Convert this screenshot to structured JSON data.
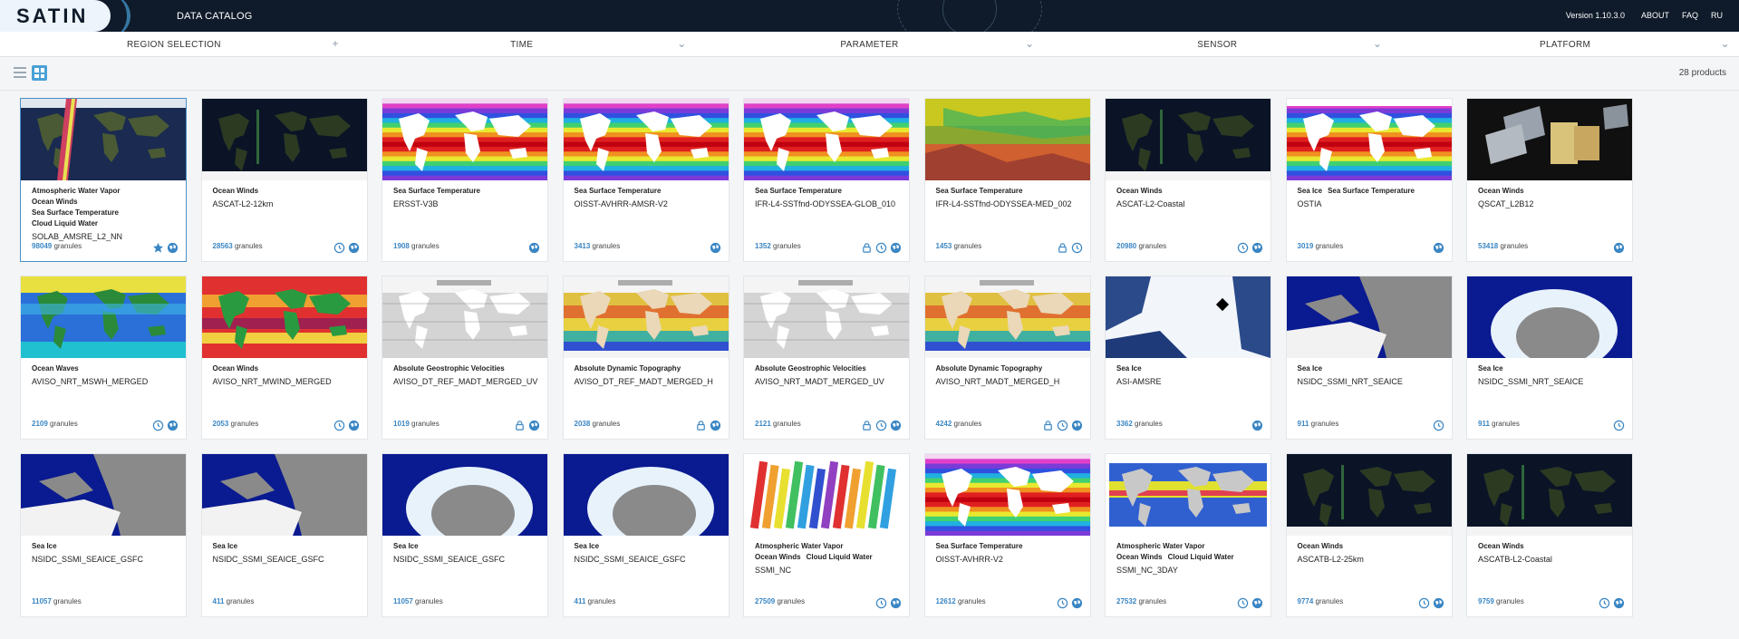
{
  "header": {
    "logo_text": "SATIN",
    "app_title": "DATA CATALOG",
    "version": "Version 1.10.3.0",
    "nav": [
      "ABOUT",
      "FAQ",
      "RU"
    ]
  },
  "filters": [
    {
      "label": "REGION SELECTION",
      "control": "+"
    },
    {
      "label": "TIME",
      "control": "⌄"
    },
    {
      "label": "PARAMETER",
      "control": "⌄"
    },
    {
      "label": "SENSOR",
      "control": "⌄"
    },
    {
      "label": "PLATFORM",
      "control": "⌄"
    }
  ],
  "toolbar": {
    "count_text": "28 products"
  },
  "colors": {
    "accent": "#3a86c4",
    "topbar": "#0f1b2a"
  },
  "granules_suffix": "granules",
  "products": [
    {
      "params": [
        "Atmospheric Water Vapor",
        "Ocean Winds",
        "Sea Surface Temperature",
        "Cloud Liquid Water"
      ],
      "name": "SOLAB_AMSRE_L2_NN",
      "count": "98049",
      "icons": [
        "star",
        "globe"
      ],
      "thumb": "swath",
      "selected": true
    },
    {
      "params": [
        "Ocean Winds"
      ],
      "name": "ASCAT-L2-12km",
      "count": "28563",
      "icons": [
        "clock",
        "globe"
      ],
      "thumb": "dark-earth"
    },
    {
      "params": [
        "Sea Surface Temperature"
      ],
      "name": "ERSST-V3B",
      "count": "1908",
      "icons": [
        "globe"
      ],
      "thumb": "sst"
    },
    {
      "params": [
        "Sea Surface Temperature"
      ],
      "name": "OISST-AVHRR-AMSR-V2",
      "count": "3413",
      "icons": [
        "globe"
      ],
      "thumb": "sst"
    },
    {
      "params": [
        "Sea Surface Temperature"
      ],
      "name": "IFR-L4-SSTfnd-ODYSSEA-GLOB_010",
      "count": "1352",
      "icons": [
        "lock",
        "clock",
        "globe"
      ],
      "thumb": "sst"
    },
    {
      "params": [
        "Sea Surface Temperature"
      ],
      "name": "IFR-L4-SSTfnd-ODYSSEA-MED_002",
      "count": "1453",
      "icons": [
        "lock",
        "clock"
      ],
      "thumb": "med"
    },
    {
      "params": [
        "Ocean Winds"
      ],
      "name": "ASCAT-L2-Coastal",
      "count": "20980",
      "icons": [
        "clock",
        "globe"
      ],
      "thumb": "dark-earth"
    },
    {
      "params": [
        "Sea Ice",
        "Sea Surface Temperature"
      ],
      "name": "OSTIA",
      "count": "3019",
      "icons": [
        "globe"
      ],
      "thumb": "ostia"
    },
    {
      "params": [
        "Ocean Winds"
      ],
      "name": "QSCAT_L2B12",
      "count": "53418",
      "icons": [
        "globe"
      ],
      "thumb": "satellite"
    },
    {
      "params": [
        "Ocean Waves"
      ],
      "name": "AVISO_NRT_MSWH_MERGED",
      "count": "2109",
      "icons": [
        "clock",
        "globe"
      ],
      "thumb": "waves"
    },
    {
      "params": [
        "Ocean Winds"
      ],
      "name": "AVISO_NRT_MWIND_MERGED",
      "count": "2053",
      "icons": [
        "clock",
        "globe"
      ],
      "thumb": "winds"
    },
    {
      "params": [
        "Absolute Geostrophic Velocities"
      ],
      "name": "AVISO_DT_REF_MADT_MERGED_UV",
      "count": "1019",
      "icons": [
        "lock",
        "globe"
      ],
      "thumb": "vectors"
    },
    {
      "params": [
        "Absolute Dynamic Topography"
      ],
      "name": "AVISO_DT_REF_MADT_MERGED_H",
      "count": "2038",
      "icons": [
        "lock",
        "globe"
      ],
      "thumb": "topo"
    },
    {
      "params": [
        "Absolute Geostrophic Velocities"
      ],
      "name": "AVISO_NRT_MADT_MERGED_UV",
      "count": "2121",
      "icons": [
        "lock",
        "clock",
        "globe"
      ],
      "thumb": "vectors"
    },
    {
      "params": [
        "Absolute Dynamic Topography"
      ],
      "name": "AVISO_NRT_MADT_MERGED_H",
      "count": "4242",
      "icons": [
        "lock",
        "clock",
        "globe"
      ],
      "thumb": "topo"
    },
    {
      "params": [
        "Sea Ice"
      ],
      "name": "ASI-AMSRE",
      "count": "3362",
      "icons": [
        "globe"
      ],
      "thumb": "arctic"
    },
    {
      "params": [
        "Sea Ice"
      ],
      "name": "NSIDC_SSMI_NRT_SEAICE",
      "count": "911",
      "icons": [
        "clock"
      ],
      "thumb": "north-ice"
    },
    {
      "params": [
        "Sea Ice"
      ],
      "name": "NSIDC_SSMI_NRT_SEAICE",
      "count": "911",
      "icons": [
        "clock"
      ],
      "thumb": "south-ice"
    },
    {
      "params": [
        "Sea Ice"
      ],
      "name": "NSIDC_SSMI_SEAICE_GSFC",
      "count": "11057",
      "icons": [],
      "thumb": "north-ice"
    },
    {
      "params": [
        "Sea Ice"
      ],
      "name": "NSIDC_SSMI_SEAICE_GSFC",
      "count": "411",
      "icons": [],
      "thumb": "north-ice"
    },
    {
      "params": [
        "Sea Ice"
      ],
      "name": "NSIDC_SSMI_SEAICE_GSFC",
      "count": "11057",
      "icons": [],
      "thumb": "south-ice"
    },
    {
      "params": [
        "Sea Ice"
      ],
      "name": "NSIDC_SSMI_SEAICE_GSFC",
      "count": "411",
      "icons": [],
      "thumb": "south-ice"
    },
    {
      "params": [
        "Atmospheric Water Vapor",
        "Ocean Winds",
        "Cloud Liquid Water"
      ],
      "name": "SSMI_NC",
      "count": "27509",
      "icons": [
        "clock",
        "globe"
      ],
      "thumb": "ssmi"
    },
    {
      "params": [
        "Sea Surface Temperature"
      ],
      "name": "OISST-AVHRR-V2",
      "count": "12612",
      "icons": [
        "clock",
        "globe"
      ],
      "thumb": "sst"
    },
    {
      "params": [
        "Atmospheric Water Vapor",
        "Ocean Winds",
        "Cloud Liquid Water"
      ],
      "name": "SSMI_NC_3DAY",
      "count": "27532",
      "icons": [
        "clock",
        "globe"
      ],
      "thumb": "ssmi3"
    },
    {
      "params": [
        "Ocean Winds"
      ],
      "name": "ASCATB-L2-25km",
      "count": "9774",
      "icons": [
        "clock",
        "globe"
      ],
      "thumb": "dark-earth"
    },
    {
      "params": [
        "Ocean Winds"
      ],
      "name": "ASCATB-L2-Coastal",
      "count": "9759",
      "icons": [
        "clock",
        "globe"
      ],
      "thumb": "dark-earth"
    }
  ]
}
